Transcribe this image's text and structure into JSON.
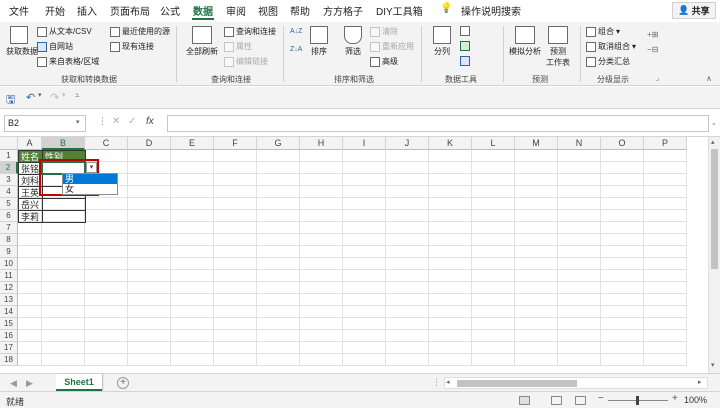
{
  "menu": {
    "tabs": [
      "文件",
      "开始",
      "插入",
      "页面布局",
      "公式",
      "数据",
      "审阅",
      "视图",
      "帮助",
      "方方格子",
      "DIY工具箱"
    ],
    "active": "数据",
    "tell_me": "操作说明搜索",
    "share": "共享"
  },
  "ribbon": {
    "get_data": "获取数据",
    "from_text_csv": "从文本/CSV",
    "from_web": "自网站",
    "from_table": "来自表格/区域",
    "recent_sources": "最近使用的源",
    "existing_conn": "现有连接",
    "group_get": "获取和转换数据",
    "refresh_all": "全部刷新",
    "queries_conn": "查询和连接",
    "properties": "属性",
    "edit_links": "编辑链接",
    "group_queries": "查询和连接",
    "sort_az": "A↓Z",
    "sort_za": "Z↓A",
    "sort": "排序",
    "filter": "筛选",
    "clear": "清除",
    "reapply": "重新应用",
    "advanced": "高级",
    "group_sort": "排序和筛选",
    "split": "分列",
    "group_tools": "数据工具",
    "what_if": "模拟分析",
    "forecast_sheet": "预测",
    "forecast_sheet_2": "工作表",
    "group_forecast": "预测",
    "group_btn": "组合",
    "ungroup": "取消组合",
    "subtotal": "分类汇总",
    "group_outline": "分级显示"
  },
  "formula_bar": {
    "name_box": "B2",
    "fx": "fx",
    "cancel": "✕",
    "enter": "✓",
    "value": ""
  },
  "grid": {
    "columns": [
      "A",
      "B",
      "C",
      "D",
      "E",
      "F",
      "G",
      "H",
      "I",
      "J",
      "K",
      "L",
      "M",
      "N",
      "O",
      "P"
    ],
    "rows": [
      "1",
      "2",
      "3",
      "4",
      "5",
      "6",
      "7",
      "8",
      "9",
      "10",
      "11",
      "12",
      "13",
      "14",
      "15",
      "16",
      "17",
      "18"
    ],
    "header_name": "姓名",
    "header_gender": "性别",
    "names": [
      "张铭",
      "刘科",
      "王英",
      "岳兴",
      "李莉"
    ]
  },
  "dropdown": {
    "options": [
      "男",
      "女"
    ]
  },
  "sheet": {
    "tab": "Sheet1"
  },
  "status": {
    "mode": "就绪",
    "zoom": "100%"
  },
  "colors": {
    "accent": "#217346",
    "header_fill": "#548235",
    "selection_outline": "#c00000",
    "dropdown_highlight": "#0078d7"
  }
}
